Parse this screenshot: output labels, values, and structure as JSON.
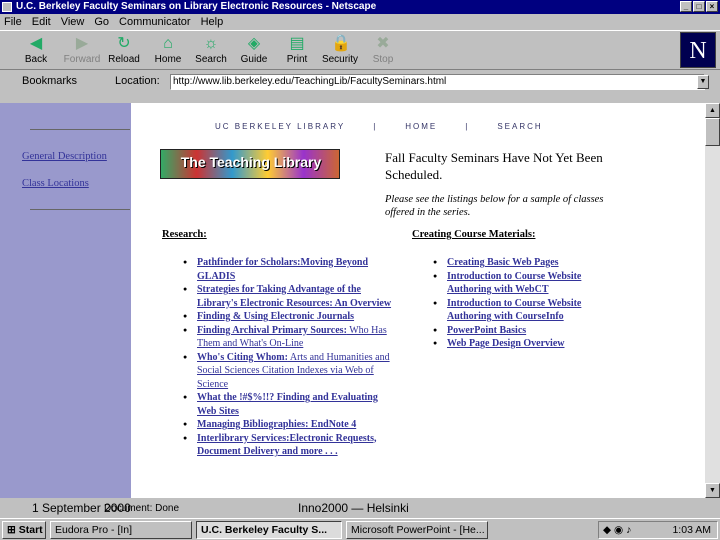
{
  "window": {
    "title": "U.C. Berkeley Faculty Seminars on Library Electronic Resources - Netscape"
  },
  "menu": [
    "File",
    "Edit",
    "View",
    "Go",
    "Communicator",
    "Help"
  ],
  "toolbar": [
    {
      "label": "Back",
      "icon": "back-arrow-icon"
    },
    {
      "label": "Forward",
      "icon": "forward-arrow-icon"
    },
    {
      "label": "Reload",
      "icon": "reload-icon"
    },
    {
      "label": "Home",
      "icon": "home-icon"
    },
    {
      "label": "Search",
      "icon": "search-icon"
    },
    {
      "label": "Guide",
      "icon": "guide-icon"
    },
    {
      "label": "Print",
      "icon": "print-icon"
    },
    {
      "label": "Security",
      "icon": "lock-icon"
    },
    {
      "label": "Stop",
      "icon": "stop-icon"
    }
  ],
  "location": {
    "bookmarks": "Bookmarks",
    "label": "Location:",
    "url": "http://www.lib.berkeley.edu/TeachingLib/FacultySeminars.html"
  },
  "page": {
    "nav": [
      "General Description",
      "Class Locations"
    ],
    "topnav": [
      "UC BERKELEY LIBRARY",
      "|",
      "HOME",
      "|",
      "SEARCH"
    ],
    "logo_text": "The Teaching Library",
    "headline": "Fall Faculty Seminars Have Not Yet Been Scheduled.",
    "subtext": "Please see the listings below for a sample of classes offered in the series.",
    "research_heading": "Research:",
    "research": [
      {
        "link": "Pathfinder for Scholars:Moving Beyond GLADIS",
        "rest": ""
      },
      {
        "link": "Strategies for Taking Advantage of the Library's Electronic Resources:  An Overview",
        "rest": ""
      },
      {
        "link": "Finding & Using Electronic Journals",
        "rest": ""
      },
      {
        "link": "Finding Archival Primary Sources:",
        "rest": " Who Has Them and What's On-Line"
      },
      {
        "link": "Who's Citing Whom:",
        "rest": " Arts and Humanities and Social Sciences Citation Indexes via Web of Science"
      },
      {
        "link": "What the !#$%!!? Finding and Evaluating Web Sites",
        "rest": ""
      },
      {
        "link": "Managing Bibliographies:  EndNote 4",
        "rest": ""
      },
      {
        "link": "Interlibrary Services:Electronic Requests, Document Delivery and more . . .",
        "rest": ""
      }
    ],
    "materials_heading": "Creating Course Materials:",
    "materials": [
      "Creating Basic Web Pages",
      "Introduction to Course Website Authoring with WebCT",
      "Introduction to Course Website Authoring with CourseInfo",
      "PowerPoint Basics",
      "Web Page Design Overview"
    ]
  },
  "status": {
    "date": "1 September 2000",
    "doc": "Document: Done",
    "footer": "Inno2000 — Helsinki"
  },
  "taskbar": {
    "start": "Start",
    "items": [
      "Eudora Pro - [In]",
      "U.C. Berkeley Faculty S...",
      "Microsoft PowerPoint - [He..."
    ],
    "clock": "1:03 AM"
  }
}
